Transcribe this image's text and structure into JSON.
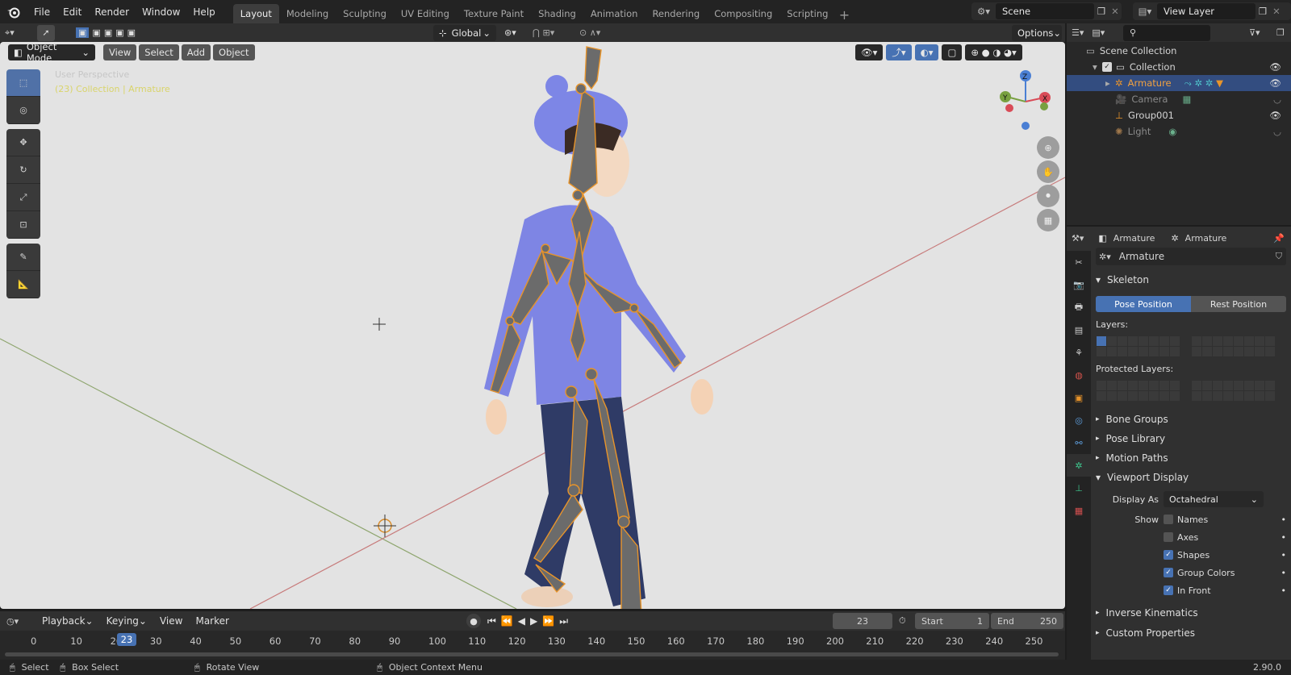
{
  "topbar": {
    "menus": [
      "File",
      "Edit",
      "Render",
      "Window",
      "Help"
    ],
    "workspaces": [
      "Layout",
      "Modeling",
      "Sculpting",
      "UV Editing",
      "Texture Paint",
      "Shading",
      "Animation",
      "Rendering",
      "Compositing",
      "Scripting"
    ],
    "active_workspace": "Layout",
    "scene_label": "Scene",
    "view_layer_label": "View Layer"
  },
  "viewport": {
    "orientation": "Global",
    "options_label": "Options",
    "mode": "Object Mode",
    "menus": [
      "View",
      "Select",
      "Add",
      "Object"
    ],
    "overlay_line1": "User Perspective",
    "overlay_line2": "(23) Collection | Armature",
    "gizmo_axes": [
      "Z",
      "Y",
      "X"
    ]
  },
  "timeline": {
    "menus": [
      "Playback",
      "Keying",
      "View",
      "Marker"
    ],
    "current_frame": "23",
    "start_label": "Start",
    "start_value": "1",
    "end_label": "End",
    "end_value": "250",
    "ticks": [
      "0",
      "10",
      "20",
      "30",
      "40",
      "50",
      "60",
      "70",
      "80",
      "90",
      "100",
      "110",
      "120",
      "130",
      "140",
      "150",
      "160",
      "170",
      "180",
      "190",
      "200",
      "210",
      "220",
      "230",
      "240",
      "250"
    ]
  },
  "status": {
    "select": "Select",
    "box_select": "Box Select",
    "rotate_view": "Rotate View",
    "context_menu": "Object Context Menu",
    "version": "2.90.0"
  },
  "outliner": {
    "scene_collection": "Scene Collection",
    "collection": "Collection",
    "items": [
      "Armature",
      "Camera",
      "Group001",
      "Light"
    ]
  },
  "properties": {
    "header_obj": "Armature",
    "header_data": "Armature",
    "data_name": "Armature",
    "skeleton_title": "Skeleton",
    "pose_position": "Pose Position",
    "rest_position": "Rest Position",
    "layers_label": "Layers:",
    "protected_layers_label": "Protected Layers:",
    "panels_collapsed": [
      "Bone Groups",
      "Pose Library",
      "Motion Paths"
    ],
    "viewport_display_title": "Viewport Display",
    "display_as_label": "Display As",
    "display_as_value": "Octahedral",
    "show_label": "Show",
    "show_items": [
      {
        "label": "Names",
        "checked": false
      },
      {
        "label": "Axes",
        "checked": false
      },
      {
        "label": "Shapes",
        "checked": true
      },
      {
        "label": "Group Colors",
        "checked": true
      },
      {
        "label": "In Front",
        "checked": true
      }
    ],
    "bottom_panels": [
      "Inverse Kinematics",
      "Custom Properties"
    ]
  },
  "colors": {
    "accent": "#4772b3",
    "armature_orange": "#e8942a",
    "background": "#1d1d1d"
  }
}
